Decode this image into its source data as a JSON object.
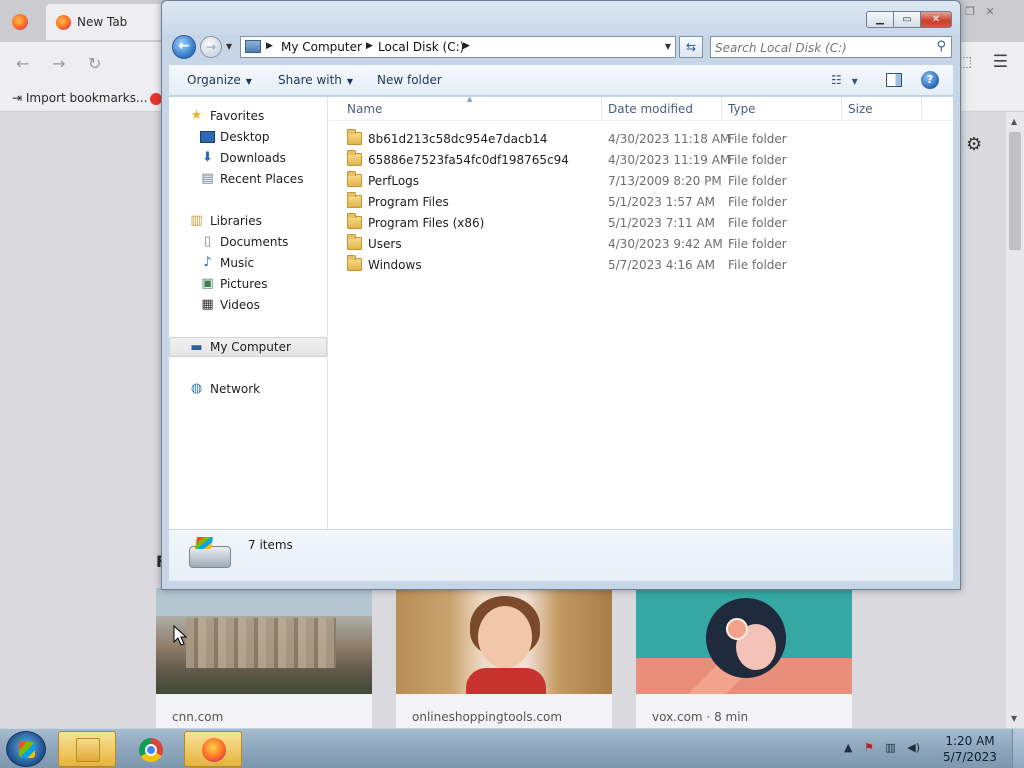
{
  "browser": {
    "tab_title": "New Tab",
    "bookmark_import": "Import bookmarks...",
    "cards": [
      {
        "source": "cnn.com"
      },
      {
        "source": "onlineshoppingtools.com"
      },
      {
        "source": "vox.com · 8 min"
      }
    ]
  },
  "explorer": {
    "address": {
      "crumbs": [
        "My Computer",
        "Local Disk (C:)"
      ]
    },
    "search": {
      "placeholder": "Search Local Disk (C:)"
    },
    "toolbar": {
      "organize": "Organize",
      "share_with": "Share with",
      "new_folder": "New folder"
    },
    "nav": {
      "favorites": "Favorites",
      "desktop": "Desktop",
      "downloads": "Downloads",
      "recent_places": "Recent Places",
      "libraries": "Libraries",
      "documents": "Documents",
      "music": "Music",
      "pictures": "Pictures",
      "videos": "Videos",
      "my_computer": "My Computer",
      "network": "Network"
    },
    "columns": {
      "name": "Name",
      "date_modified": "Date modified",
      "type": "Type",
      "size": "Size"
    },
    "files": [
      {
        "name": "8b61d213c58dc954e7dacb14",
        "date": "4/30/2023 11:18 AM",
        "type": "File folder"
      },
      {
        "name": "65886e7523fa54fc0df198765c94",
        "date": "4/30/2023 11:19 AM",
        "type": "File folder"
      },
      {
        "name": "PerfLogs",
        "date": "7/13/2009 8:20 PM",
        "type": "File folder"
      },
      {
        "name": "Program Files",
        "date": "5/1/2023 1:57 AM",
        "type": "File folder"
      },
      {
        "name": "Program Files (x86)",
        "date": "5/1/2023 7:11 AM",
        "type": "File folder"
      },
      {
        "name": "Users",
        "date": "4/30/2023 9:42 AM",
        "type": "File folder"
      },
      {
        "name": "Windows",
        "date": "5/7/2023 4:16 AM",
        "type": "File folder"
      }
    ],
    "status": {
      "item_count": "7 items"
    }
  },
  "taskbar": {
    "time": "1:20 AM",
    "date": "5/7/2023"
  }
}
